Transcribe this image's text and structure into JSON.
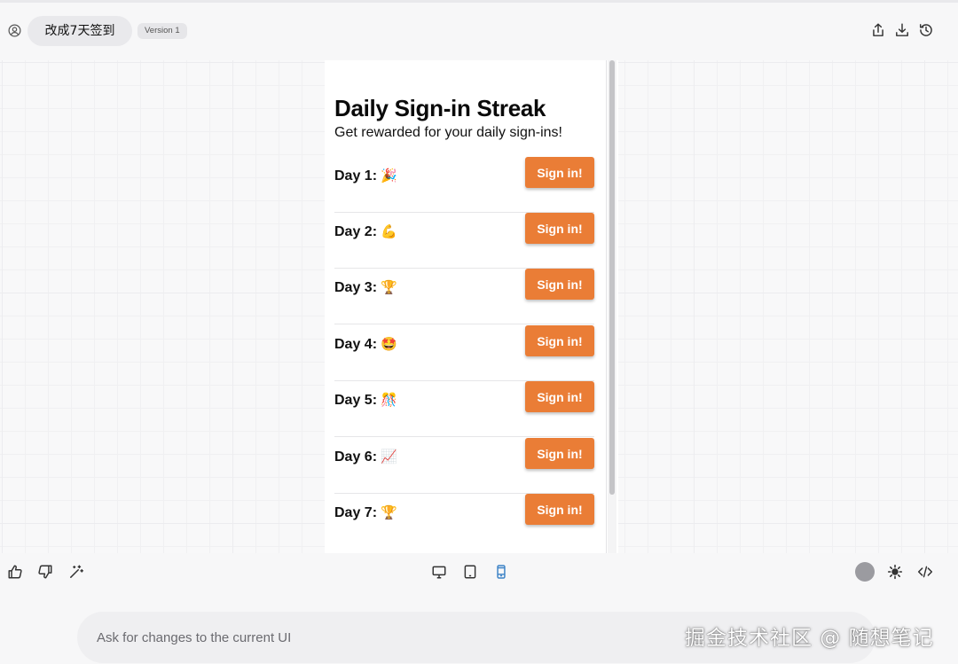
{
  "header": {
    "title": "改成7天签到",
    "version": "Version 1",
    "icons": [
      "user-icon",
      "share-icon",
      "download-icon",
      "history-icon"
    ]
  },
  "app": {
    "title": "Daily Sign-in Streak",
    "subtitle": "Get rewarded for your daily sign-ins!",
    "days": [
      {
        "label": "Day 1:",
        "emoji": "🎉",
        "button": "Sign in!"
      },
      {
        "label": "Day 2:",
        "emoji": "💪",
        "button": "Sign in!"
      },
      {
        "label": "Day 3:",
        "emoji": "🏆",
        "button": "Sign in!"
      },
      {
        "label": "Day 4:",
        "emoji": "🤩",
        "button": "Sign in!"
      },
      {
        "label": "Day 5:",
        "emoji": "🎊",
        "button": "Sign in!"
      },
      {
        "label": "Day 6:",
        "emoji": "📈",
        "button": "Sign in!"
      },
      {
        "label": "Day 7:",
        "emoji": "🏆",
        "button": "Sign in!"
      }
    ],
    "accent_color": "#ea7d36"
  },
  "toolbar": {
    "left_icons": [
      "thumbs-up-icon",
      "thumbs-down-icon",
      "magic-wand-icon"
    ],
    "device_icons": [
      "desktop-icon",
      "tablet-icon",
      "mobile-icon"
    ],
    "active_device": "mobile",
    "right_icons": [
      "theme-toggle-icon",
      "sun-icon",
      "code-icon"
    ]
  },
  "prompt": {
    "placeholder": "Ask for changes to the current UI"
  },
  "watermark": "掘金技术社区 @ 随想笔记"
}
